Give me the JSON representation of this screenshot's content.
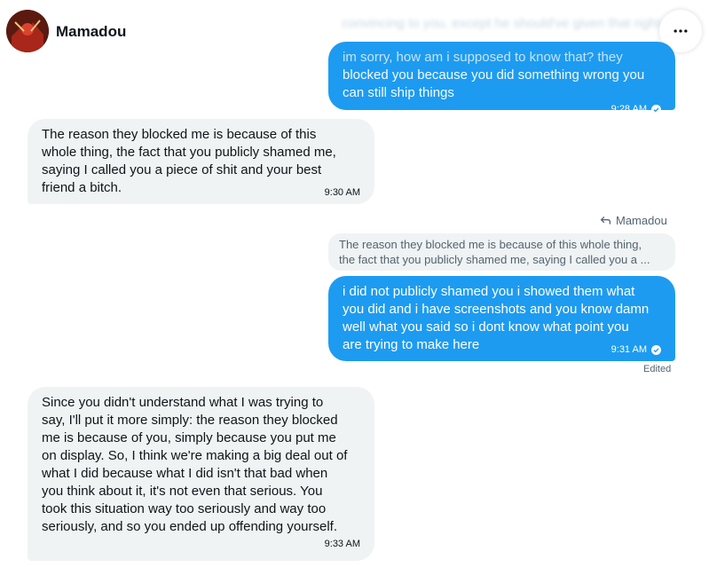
{
  "header": {
    "name": "Mamadou",
    "faded_preview": "convincing to you, except he should've given that right away"
  },
  "messages": {
    "m1": {
      "lines": [
        "im sorry, how am i supposed to know that? they",
        "blocked you because you did something wrong you",
        "can still ship things"
      ],
      "time": "9:28 AM"
    },
    "m2": {
      "lines": [
        "The reason they blocked me is because of this",
        "whole thing, the fact that you publicly shamed me,",
        "saying I called you a piece of shit and your best",
        "friend a bitch."
      ],
      "time": "9:30 AM"
    },
    "reply": {
      "to": "Mamadou",
      "quoted_lines": [
        "The reason they blocked me is because of this whole thing,",
        "the fact that you publicly shamed me, saying I called you a ..."
      ]
    },
    "m4": {
      "lines": [
        "i did not publicly shamed you i showed them what",
        "you did and i have screenshots and you know damn",
        "well what you said so i dont know what point you",
        "are trying to make here"
      ],
      "time": "9:31 AM",
      "edited": "Edited"
    },
    "m5": {
      "lines": [
        "Since you didn't understand what I was trying to",
        "say, I'll put it more simply: the reason they blocked",
        "me is because of you, simply because you put me",
        "on display. So, I think we're making a big deal out of",
        "what I did because what I did isn't that bad when",
        "you think about it, it's not even that serious. You",
        "took this situation way too seriously and way too",
        "seriously, and so you ended up offending yourself."
      ],
      "time": "9:33 AM"
    }
  },
  "icons": {
    "more": "more-horizontal-icon",
    "check": "sent-check-icon",
    "reply": "reply-arrow-icon"
  },
  "colors": {
    "outgoing": "#1d9bf0",
    "incoming": "#eff3f4",
    "muted": "#536471"
  }
}
